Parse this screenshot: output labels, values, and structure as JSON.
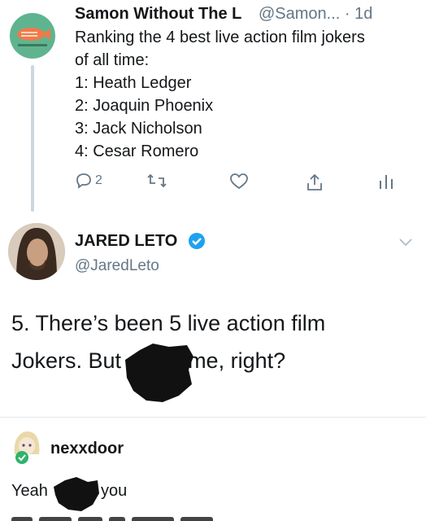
{
  "tweet": {
    "author_name": "Samon Without The L",
    "author_handle": "@Samon...",
    "time": "1d",
    "lines": [
      "Ranking the 4 best live action film jokers",
      "of all time:",
      "1: Heath Ledger",
      "2: Joaquin Phoenix",
      "3: Jack Nicholson",
      "4: Cesar Romero"
    ],
    "reply_count": "2",
    "icons": [
      "reply-icon",
      "retweet-icon",
      "like-icon",
      "share-icon",
      "analytics-icon"
    ]
  },
  "reply": {
    "author_name": "JARED LETO",
    "author_handle": "@JaredLeto",
    "text_line1": "5. There’s been 5 live action film",
    "text_line2_start": "Jokers. But",
    "text_line2_end": "me, right?",
    "verified_color": "#1da1f2"
  },
  "comment": {
    "author_name": "nexxdoor",
    "text_start": "Yeah",
    "text_end": "you"
  }
}
